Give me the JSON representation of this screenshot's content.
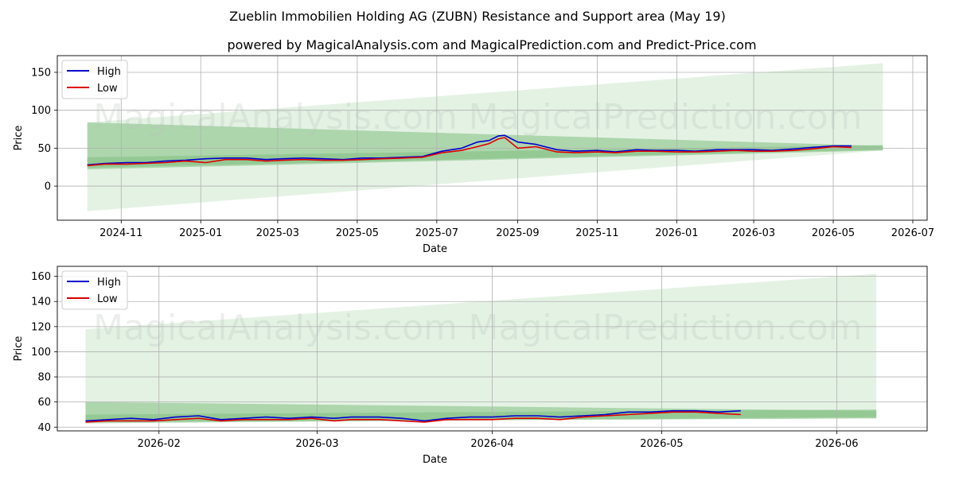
{
  "title": "Zueblin Immobilien Holding AG (ZUBN) Resistance and Support area (May 19)",
  "subtitle": "powered by MagicalAnalysis.com and MagicalPrediction.com and Predict-Price.com",
  "watermarks": [
    "MagicalAnalysis.com",
    "MagicalPrediction.com"
  ],
  "colors": {
    "high": "#0000cc",
    "low": "#dd0000",
    "band_light": "#e3f1e3",
    "band_dark": "#7fbf7f"
  },
  "chart_data": [
    {
      "type": "line",
      "xlabel": "Date",
      "ylabel": "Price",
      "xlim": [
        "2024-09-13",
        "2026-07-12"
      ],
      "ylim": [
        -45,
        172
      ],
      "yticks": [
        0,
        50,
        100,
        150
      ],
      "xticks": [
        "2024-11",
        "2025-01",
        "2025-03",
        "2025-05",
        "2025-07",
        "2025-09",
        "2025-11",
        "2026-01",
        "2026-03",
        "2026-05",
        "2026-07"
      ],
      "grid": true,
      "legend": "top-left",
      "bands": [
        {
          "x": [
            "2024-10-06",
            "2026-06-08"
          ],
          "upper": [
            84,
            162
          ],
          "lower": [
            -33,
            47
          ],
          "shade": "light"
        },
        {
          "x": [
            "2024-10-06",
            "2026-06-08"
          ],
          "upper": [
            84,
            53
          ],
          "lower": [
            22,
            47
          ],
          "shade": "dark"
        },
        {
          "x": [
            "2024-10-06",
            "2026-06-08"
          ],
          "upper": [
            38,
            54
          ],
          "lower": [
            24,
            48
          ],
          "shade": "dark"
        }
      ],
      "series": [
        {
          "name": "High",
          "color": "#0000cc",
          "x": [
            "2024-10-06",
            "2024-10-20",
            "2024-11-05",
            "2024-11-20",
            "2024-12-05",
            "2024-12-20",
            "2025-01-05",
            "2025-01-20",
            "2025-02-05",
            "2025-02-20",
            "2025-03-05",
            "2025-03-20",
            "2025-04-05",
            "2025-04-20",
            "2025-05-05",
            "2025-05-20",
            "2025-06-05",
            "2025-06-20",
            "2025-07-05",
            "2025-07-20",
            "2025-08-01",
            "2025-08-10",
            "2025-08-17",
            "2025-08-22",
            "2025-09-01",
            "2025-09-15",
            "2025-10-01",
            "2025-10-15",
            "2025-11-01",
            "2025-11-15",
            "2025-12-01",
            "2025-12-15",
            "2026-01-01",
            "2026-01-15",
            "2026-02-01",
            "2026-02-15",
            "2026-03-01",
            "2026-03-15",
            "2026-04-01",
            "2026-04-15",
            "2026-05-01",
            "2026-05-15"
          ],
          "values": [
            28,
            30,
            31,
            31,
            33,
            34,
            36,
            37,
            37,
            35,
            36,
            37,
            36,
            35,
            37,
            37,
            38,
            39,
            46,
            50,
            58,
            60,
            66,
            67,
            58,
            55,
            48,
            46,
            47,
            45,
            48,
            47,
            47,
            46,
            48,
            48,
            48,
            47,
            49,
            51,
            53,
            53
          ]
        },
        {
          "name": "Low",
          "color": "#dd0000",
          "x": [
            "2024-10-06",
            "2024-10-20",
            "2024-11-05",
            "2024-11-20",
            "2024-12-05",
            "2024-12-20",
            "2025-01-05",
            "2025-01-20",
            "2025-02-05",
            "2025-02-20",
            "2025-03-05",
            "2025-03-20",
            "2025-04-05",
            "2025-04-20",
            "2025-05-05",
            "2025-05-20",
            "2025-06-05",
            "2025-06-20",
            "2025-07-05",
            "2025-07-20",
            "2025-08-01",
            "2025-08-10",
            "2025-08-17",
            "2025-08-22",
            "2025-09-01",
            "2025-09-15",
            "2025-10-01",
            "2025-10-15",
            "2025-11-01",
            "2025-11-15",
            "2025-12-01",
            "2025-12-15",
            "2026-01-01",
            "2026-01-15",
            "2026-02-01",
            "2026-02-15",
            "2026-03-01",
            "2026-03-15",
            "2026-04-01",
            "2026-04-15",
            "2026-05-01",
            "2026-05-15"
          ],
          "values": [
            27,
            29,
            29,
            30,
            31,
            33,
            31,
            35,
            35,
            33,
            34,
            35,
            34,
            34,
            35,
            36,
            37,
            38,
            44,
            47,
            52,
            56,
            62,
            64,
            50,
            52,
            45,
            44,
            45,
            44,
            46,
            46,
            45,
            45,
            46,
            47,
            46,
            46,
            47,
            49,
            52,
            51
          ]
        }
      ]
    },
    {
      "type": "line",
      "xlabel": "Date",
      "ylabel": "Price",
      "xlim": [
        "2026-01-14",
        "2026-06-17"
      ],
      "ylim": [
        37,
        168
      ],
      "yticks": [
        40,
        60,
        80,
        100,
        120,
        140,
        160
      ],
      "xticks": [
        "2026-02",
        "2026-03",
        "2026-04",
        "2026-05",
        "2026-06"
      ],
      "grid": true,
      "legend": "top-left",
      "bands": [
        {
          "x": [
            "2026-01-19",
            "2026-06-08"
          ],
          "upper": [
            118,
            162
          ],
          "lower": [
            44,
            47
          ],
          "shade": "light"
        },
        {
          "x": [
            "2026-01-19",
            "2026-06-08"
          ],
          "upper": [
            60,
            53
          ],
          "lower": [
            44,
            47
          ],
          "shade": "dark"
        },
        {
          "x": [
            "2026-01-19",
            "2026-06-08"
          ],
          "upper": [
            50,
            54
          ],
          "lower": [
            43,
            48
          ],
          "shade": "dark"
        }
      ],
      "series": [
        {
          "name": "High",
          "color": "#0000cc",
          "x": [
            "2026-01-19",
            "2026-01-23",
            "2026-01-27",
            "2026-01-31",
            "2026-02-04",
            "2026-02-08",
            "2026-02-12",
            "2026-02-16",
            "2026-02-20",
            "2026-02-24",
            "2026-02-28",
            "2026-03-04",
            "2026-03-07",
            "2026-03-12",
            "2026-03-16",
            "2026-03-20",
            "2026-03-24",
            "2026-03-28",
            "2026-04-01",
            "2026-04-05",
            "2026-04-09",
            "2026-04-13",
            "2026-04-17",
            "2026-04-21",
            "2026-04-25",
            "2026-04-29",
            "2026-05-03",
            "2026-05-07",
            "2026-05-11",
            "2026-05-15"
          ],
          "values": [
            45,
            46,
            47,
            46,
            48,
            49,
            46,
            47,
            48,
            47,
            48,
            47,
            48,
            48,
            47,
            45,
            47,
            48,
            48,
            49,
            49,
            48,
            49,
            50,
            52,
            52,
            53,
            53,
            52,
            53
          ]
        },
        {
          "name": "Low",
          "color": "#dd0000",
          "x": [
            "2026-01-19",
            "2026-01-23",
            "2026-01-27",
            "2026-01-31",
            "2026-02-04",
            "2026-02-08",
            "2026-02-12",
            "2026-02-16",
            "2026-02-20",
            "2026-02-24",
            "2026-02-28",
            "2026-03-04",
            "2026-03-07",
            "2026-03-12",
            "2026-03-16",
            "2026-03-20",
            "2026-03-24",
            "2026-03-28",
            "2026-04-01",
            "2026-04-05",
            "2026-04-09",
            "2026-04-13",
            "2026-04-17",
            "2026-04-21",
            "2026-04-25",
            "2026-04-29",
            "2026-05-03",
            "2026-05-07",
            "2026-05-11",
            "2026-05-15"
          ],
          "values": [
            44,
            45,
            45,
            45,
            46,
            47,
            45,
            46,
            46,
            46,
            47,
            45,
            46,
            46,
            45,
            44,
            46,
            46,
            46,
            47,
            47,
            46,
            48,
            49,
            50,
            51,
            52,
            52,
            51,
            50
          ]
        }
      ]
    }
  ]
}
